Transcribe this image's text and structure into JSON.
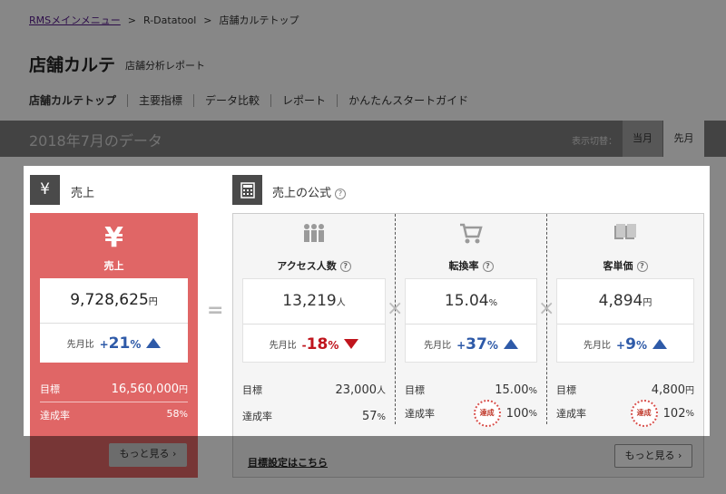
{
  "breadcrumb": {
    "items": [
      "RMSメインメニュー",
      "R-Datatool",
      "店舗カルテトップ"
    ],
    "separator": ">"
  },
  "header": {
    "title": "店舗カルテ",
    "subtitle": "店舗分析レポート"
  },
  "nav": {
    "tabs": [
      "店舗カルテトップ",
      "主要指標",
      "データ比較",
      "レポート",
      "かんたんスタートガイド"
    ],
    "active_index": 0
  },
  "databar": {
    "title": "2018年7月のデータ",
    "switch_label": "表示切替：",
    "current_month": "当月",
    "last_month": "先月"
  },
  "sales": {
    "section_icon": "yen-icon",
    "section_title": "売上",
    "panel_label": "売上",
    "value": "9,728,625",
    "unit": "円",
    "compare_label": "先月比",
    "compare_sign": "+",
    "compare_value": "21",
    "compare_unit": "%",
    "trend": "up",
    "target_label": "目標",
    "target_value": "16,560,000",
    "target_unit": "円",
    "rate_label": "達成率",
    "rate_value": "58",
    "rate_unit": "%",
    "more_label": "もっと見る ›",
    "color": "#e06666"
  },
  "formula": {
    "section_icon": "calculator-icon",
    "section_title": "売上の公式",
    "equals": "=",
    "times": "×",
    "goal_link": "目標設定はこちら",
    "more_label": "もっと見る ›",
    "columns": [
      {
        "icon": "people-icon",
        "label": "アクセス人数",
        "value": "13,219",
        "unit": "人",
        "compare_label": "先月比",
        "compare_sign": "-",
        "compare_value": "18",
        "compare_unit": "%",
        "trend": "down",
        "target_label": "目標",
        "target_value": "23,000",
        "target_unit": "人",
        "rate_label": "達成率",
        "rate_value": "57",
        "rate_unit": "%",
        "achieved": false
      },
      {
        "icon": "cart-icon",
        "label": "転換率",
        "value": "15.04",
        "unit": "%",
        "compare_label": "先月比",
        "compare_sign": "+",
        "compare_value": "37",
        "compare_unit": "%",
        "trend": "up",
        "target_label": "目標",
        "target_value": "15.00",
        "target_unit": "%",
        "rate_label": "達成率",
        "rate_value": "100",
        "rate_unit": "%",
        "achieved": true,
        "badge_label": "達成"
      },
      {
        "icon": "books-icon",
        "label": "客単価",
        "value": "4,894",
        "unit": "円",
        "compare_label": "先月比",
        "compare_sign": "+",
        "compare_value": "9",
        "compare_unit": "%",
        "trend": "up",
        "target_label": "目標",
        "target_value": "4,800",
        "target_unit": "円",
        "rate_label": "達成率",
        "rate_value": "102",
        "rate_unit": "%",
        "achieved": true,
        "badge_label": "達成"
      }
    ]
  },
  "colors": {
    "positive": "#2e5aa8",
    "negative": "#c0151d",
    "sales_panel": "#e06666",
    "databar": "#7f7f7f"
  }
}
